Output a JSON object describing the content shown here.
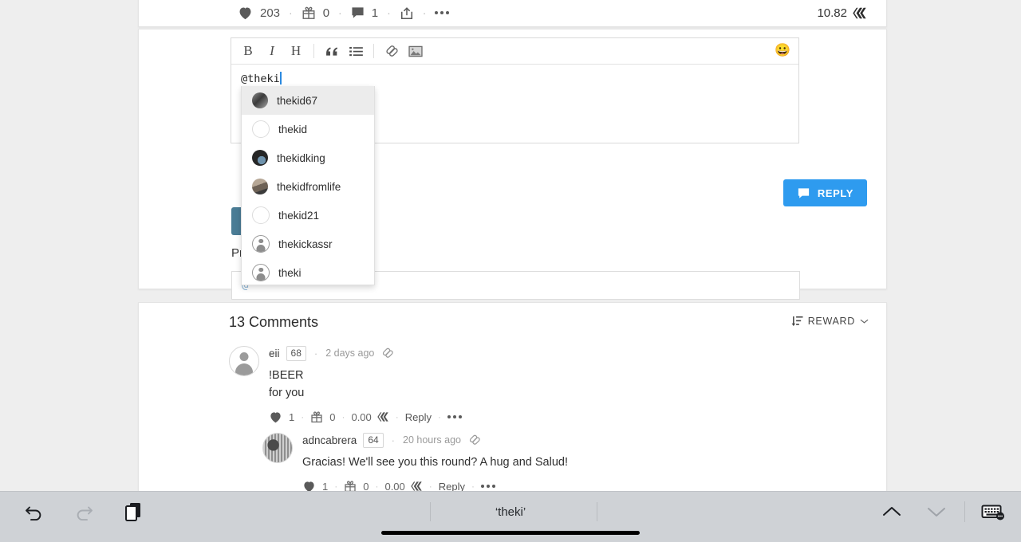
{
  "post_stats": {
    "likes": "203",
    "gifts": "0",
    "comments": "1",
    "payout": "10.82",
    "more_icon": "ellipsis-icon",
    "heart_icon": "heart-icon",
    "gift_icon": "gift-icon",
    "comment_icon": "comment-icon",
    "share_icon": "share-icon",
    "hive_icon": "hive-logo-icon"
  },
  "editor": {
    "toolbar": [
      {
        "label": "B",
        "name": "bold-button"
      },
      {
        "label": "I",
        "name": "italic-button"
      },
      {
        "label": "H",
        "name": "heading-button"
      },
      {
        "label": "“",
        "name": "blockquote-button"
      },
      {
        "label": "☰",
        "name": "bullet-list-button"
      },
      {
        "label": "🔗",
        "name": "link-button"
      },
      {
        "label": "🖼",
        "name": "image-button"
      }
    ],
    "emoji_button": "😀",
    "text_value": "@theki",
    "hidden_text": "Pr",
    "hidden_input_value": "@",
    "reply_label": "REPLY"
  },
  "autocomplete": {
    "items": [
      {
        "name": "thekid67",
        "avatar": "photo",
        "selected": true
      },
      {
        "name": "thekid",
        "avatar": "blank",
        "selected": false
      },
      {
        "name": "thekidking",
        "avatar": "photo2",
        "selected": false
      },
      {
        "name": "thekidfromlife",
        "avatar": "photo3",
        "selected": false
      },
      {
        "name": "thekid21",
        "avatar": "blank",
        "selected": false
      },
      {
        "name": "thekickassr",
        "avatar": "placeholder",
        "selected": false
      },
      {
        "name": "theki",
        "avatar": "placeholder",
        "selected": false
      }
    ]
  },
  "comments_section": {
    "title": "13 Comments",
    "sort_label": "REWARD",
    "sort_icon": "sort-descending-icon",
    "chevron_icon": "chevron-down-icon",
    "comments": [
      {
        "user": "eii",
        "reputation": "68",
        "time": "2 days ago",
        "text_line1": "!BEER",
        "text_line2": "for you",
        "likes": "1",
        "gifts": "0",
        "payout": "0.00",
        "reply_label": "Reply"
      },
      {
        "user": "adncabrera",
        "reputation": "64",
        "time": "20 hours ago",
        "text_line1": "Gracias! We'll see you this round? A hug and Salud!",
        "likes": "1",
        "gifts": "0",
        "payout": "0.00",
        "reply_label": "Reply"
      }
    ]
  },
  "keyboard_toolbar": {
    "undo_icon": "undo-icon",
    "redo_icon": "redo-icon",
    "clipboard_icon": "clipboard-icon",
    "suggestion": "‘theki’",
    "up_icon": "chevron-up-icon",
    "down_icon": "chevron-down-icon",
    "keyboard_icon": "keyboard-settings-icon"
  },
  "colors": {
    "accent_blue": "#2e9bef",
    "page_bg": "#eeeeee",
    "keyboard_bg": "#cfd2d6",
    "caret": "#2b8ae0"
  }
}
